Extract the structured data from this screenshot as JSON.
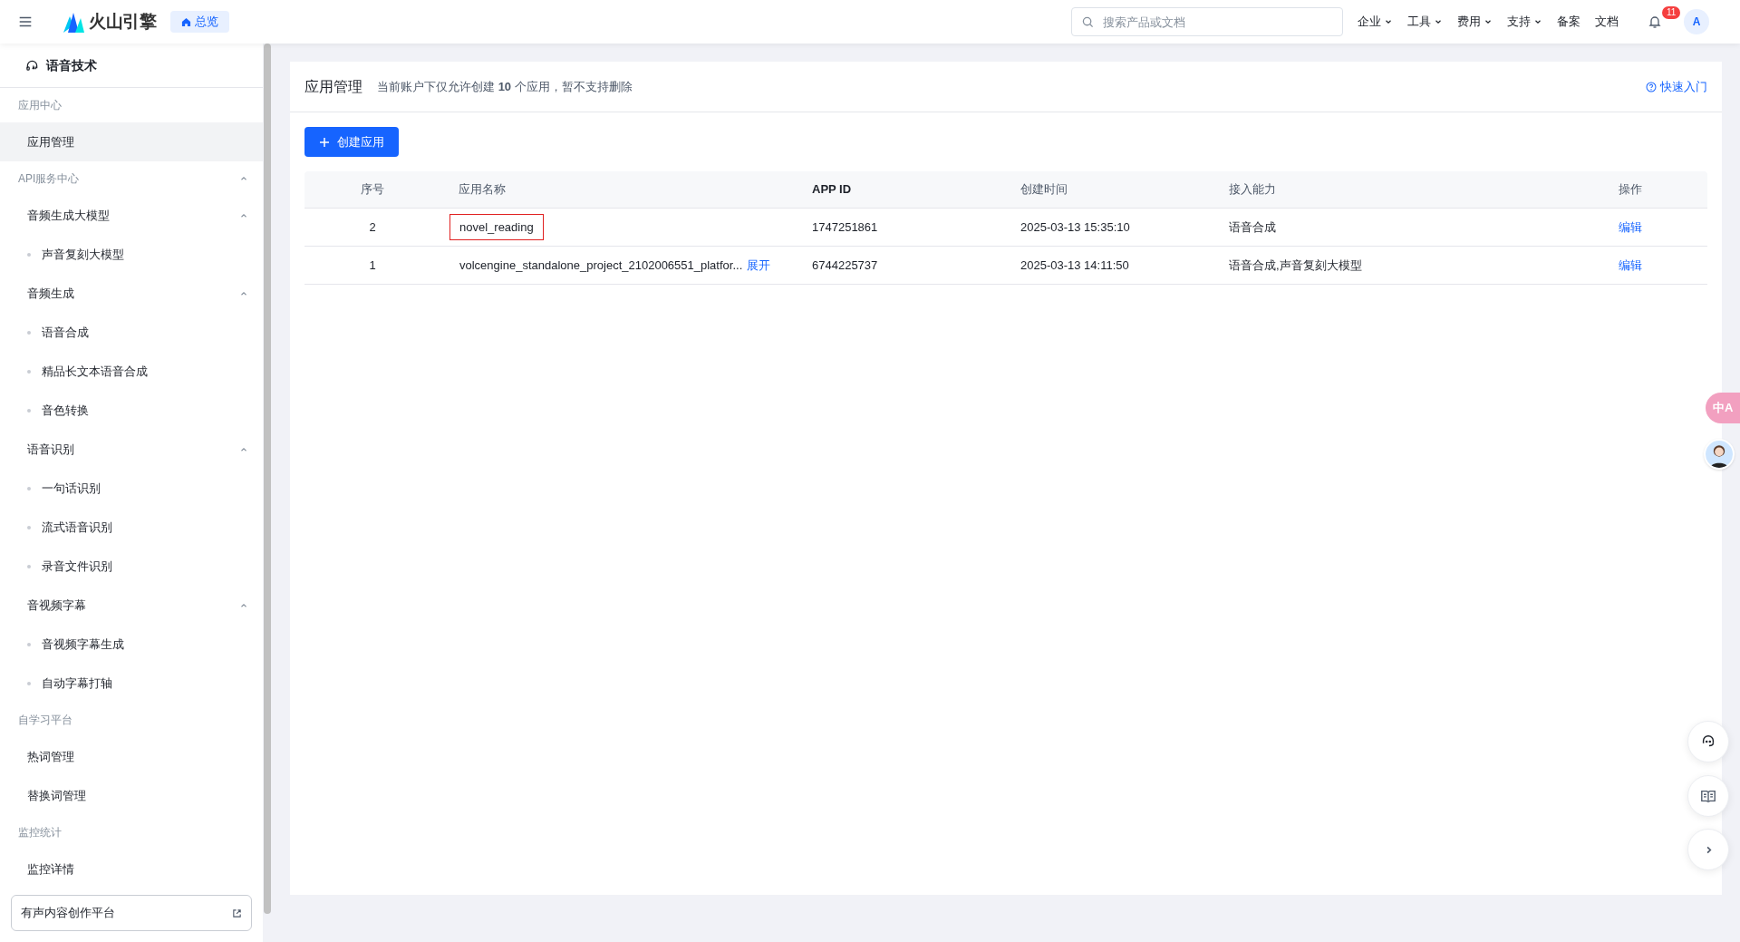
{
  "topbar": {
    "brand": "火山引擎",
    "overview_tab": {
      "label": "总览",
      "selected": true
    },
    "search": {
      "placeholder": "搜索产品或文档"
    },
    "menus": [
      {
        "label": "企业",
        "dropdown": true
      },
      {
        "label": "工具",
        "dropdown": true
      },
      {
        "label": "费用",
        "dropdown": true
      },
      {
        "label": "支持",
        "dropdown": true
      },
      {
        "label": "备案",
        "dropdown": false
      },
      {
        "label": "文档",
        "dropdown": false
      }
    ],
    "notifications": "11",
    "avatar": "A"
  },
  "sidebar": {
    "title": "语音技术",
    "sections": [
      {
        "label": "应用中心",
        "items": [
          {
            "label": "应用管理",
            "selected": true
          }
        ]
      },
      {
        "label": "API服务中心",
        "expanded": true,
        "items": [
          {
            "label": "音频生成大模型",
            "selected": false,
            "expanded": true,
            "children": [
              {
                "label": "声音复刻大模型",
                "selected": false
              }
            ]
          },
          {
            "label": "音频生成",
            "selected": false,
            "expanded": true,
            "children": [
              {
                "label": "语音合成",
                "selected": false
              },
              {
                "label": "精品长文本语音合成",
                "selected": false
              },
              {
                "label": "音色转换",
                "selected": false
              }
            ]
          },
          {
            "label": "语音识别",
            "selected": false,
            "expanded": true,
            "children": [
              {
                "label": "一句话识别",
                "selected": false
              },
              {
                "label": "流式语音识别",
                "selected": false
              },
              {
                "label": "录音文件识别",
                "selected": false
              }
            ]
          },
          {
            "label": "音视频字幕",
            "selected": false,
            "expanded": true,
            "children": [
              {
                "label": "音视频字幕生成",
                "selected": false
              },
              {
                "label": "自动字幕打轴",
                "selected": false
              }
            ]
          }
        ]
      },
      {
        "label": "自学习平台",
        "items": [
          {
            "label": "热词管理",
            "selected": false
          },
          {
            "label": "替换词管理",
            "selected": false
          }
        ]
      },
      {
        "label": "监控统计",
        "items": [
          {
            "label": "监控详情",
            "selected": false
          }
        ]
      }
    ],
    "footer_link": "有声内容创作平台"
  },
  "page": {
    "title": "应用管理",
    "notice": "当前账户下仅允许创建 **10** 个应用，暂不支持删除",
    "help_link": "快速入门",
    "create_button": "创建应用",
    "table": {
      "columns": [
        "序号",
        "应用名称",
        "APP ID",
        "创建时间",
        "接入能力",
        "操作"
      ],
      "rows": [
        {
          "index": "2",
          "name": "novel_reading",
          "highlighted": true,
          "expand_link": null,
          "app_id": "1747251861",
          "created": "2025-03-13 15:35:10",
          "abilities": "语音合成",
          "action": "编辑"
        },
        {
          "index": "1",
          "name": "volcengine_standalone_project_2102006551_platfor...",
          "highlighted": false,
          "expand_link": "展开",
          "app_id": "6744225737",
          "created": "2025-03-13 14:11:50",
          "abilities": "语音合成,声音复刻大模型",
          "action": "编辑"
        }
      ]
    }
  },
  "floating": {
    "translate_button": "中A"
  }
}
